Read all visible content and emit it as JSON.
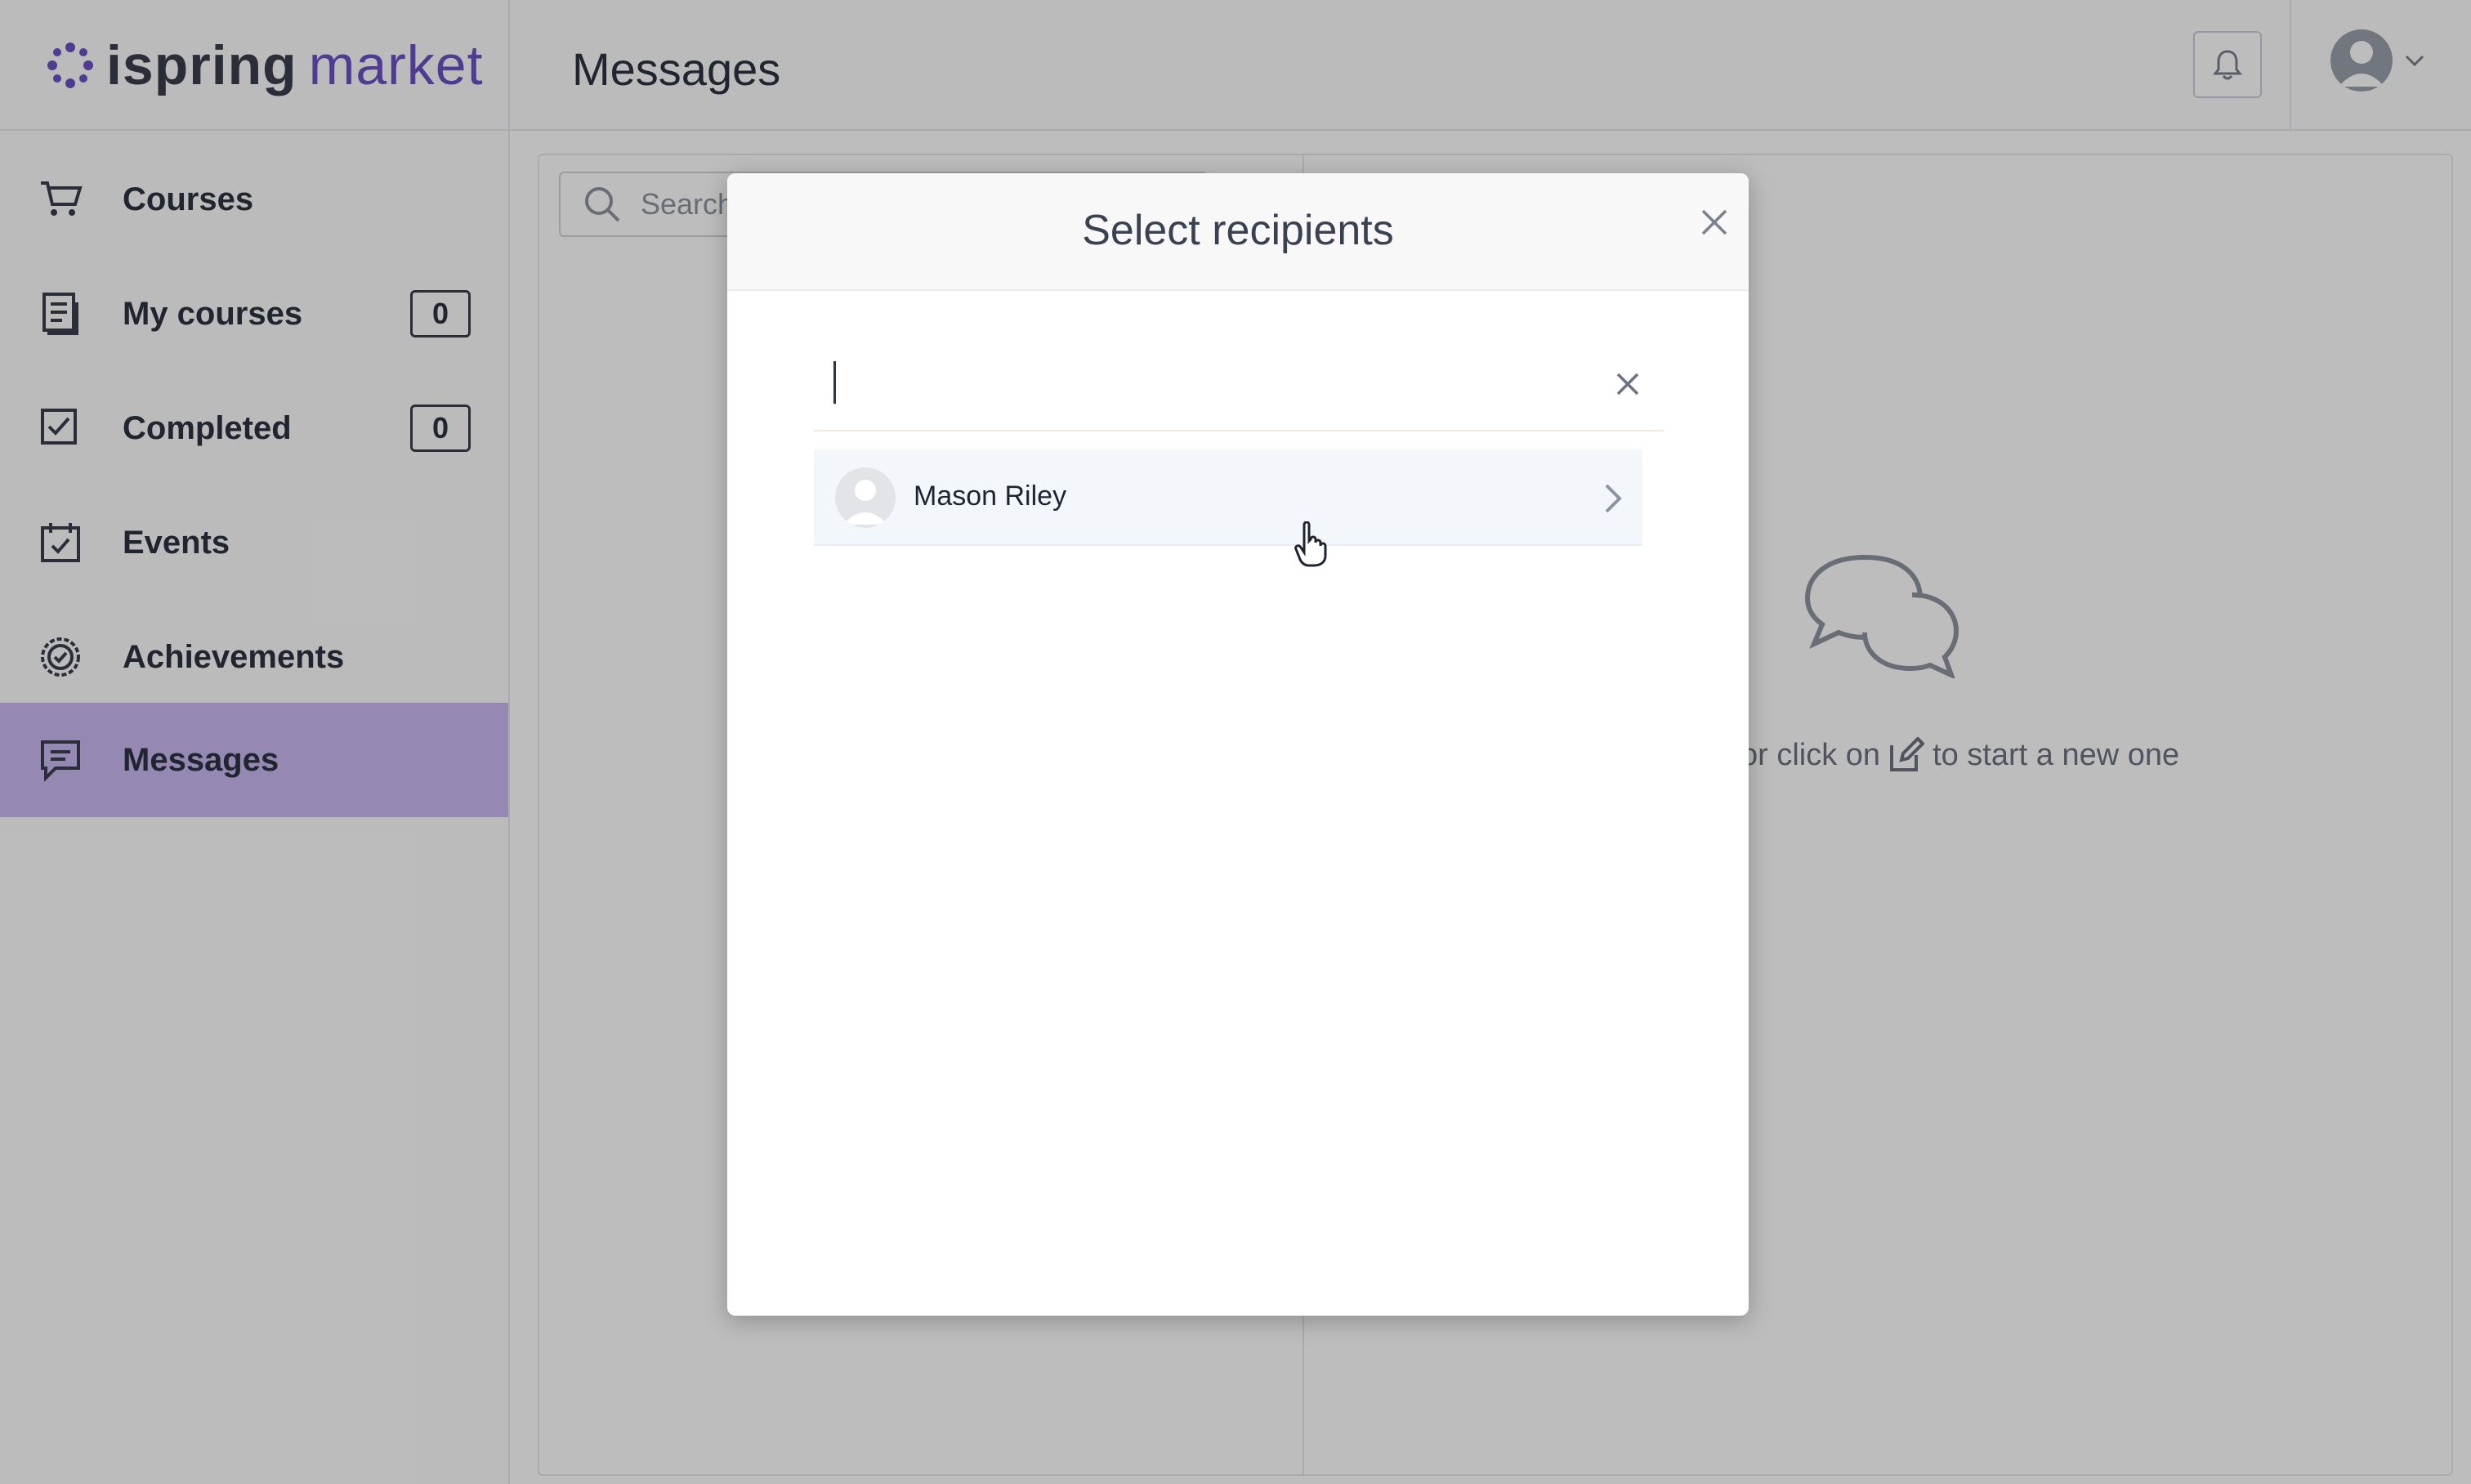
{
  "brand": {
    "name_part1": "ispring",
    "name_part2": "market",
    "accent": "#6b50c6"
  },
  "header": {
    "title": "Messages"
  },
  "sidebar": {
    "items": [
      {
        "label": "Courses",
        "icon": "cart-icon"
      },
      {
        "label": "My courses",
        "icon": "notebook-icon",
        "count": "0"
      },
      {
        "label": "Completed",
        "icon": "checkbox-icon",
        "count": "0"
      },
      {
        "label": "Events",
        "icon": "calendar-check-icon"
      },
      {
        "label": "Achievements",
        "icon": "badge-icon"
      },
      {
        "label": "Messages",
        "icon": "message-icon",
        "active": true
      }
    ]
  },
  "messages": {
    "search_placeholder": "Search",
    "empty_hint_prefix": "or click on",
    "empty_hint_suffix": "to start a new one"
  },
  "modal": {
    "title": "Select recipients",
    "search_value": "",
    "recipients": [
      {
        "name": "Mason Riley"
      }
    ]
  }
}
